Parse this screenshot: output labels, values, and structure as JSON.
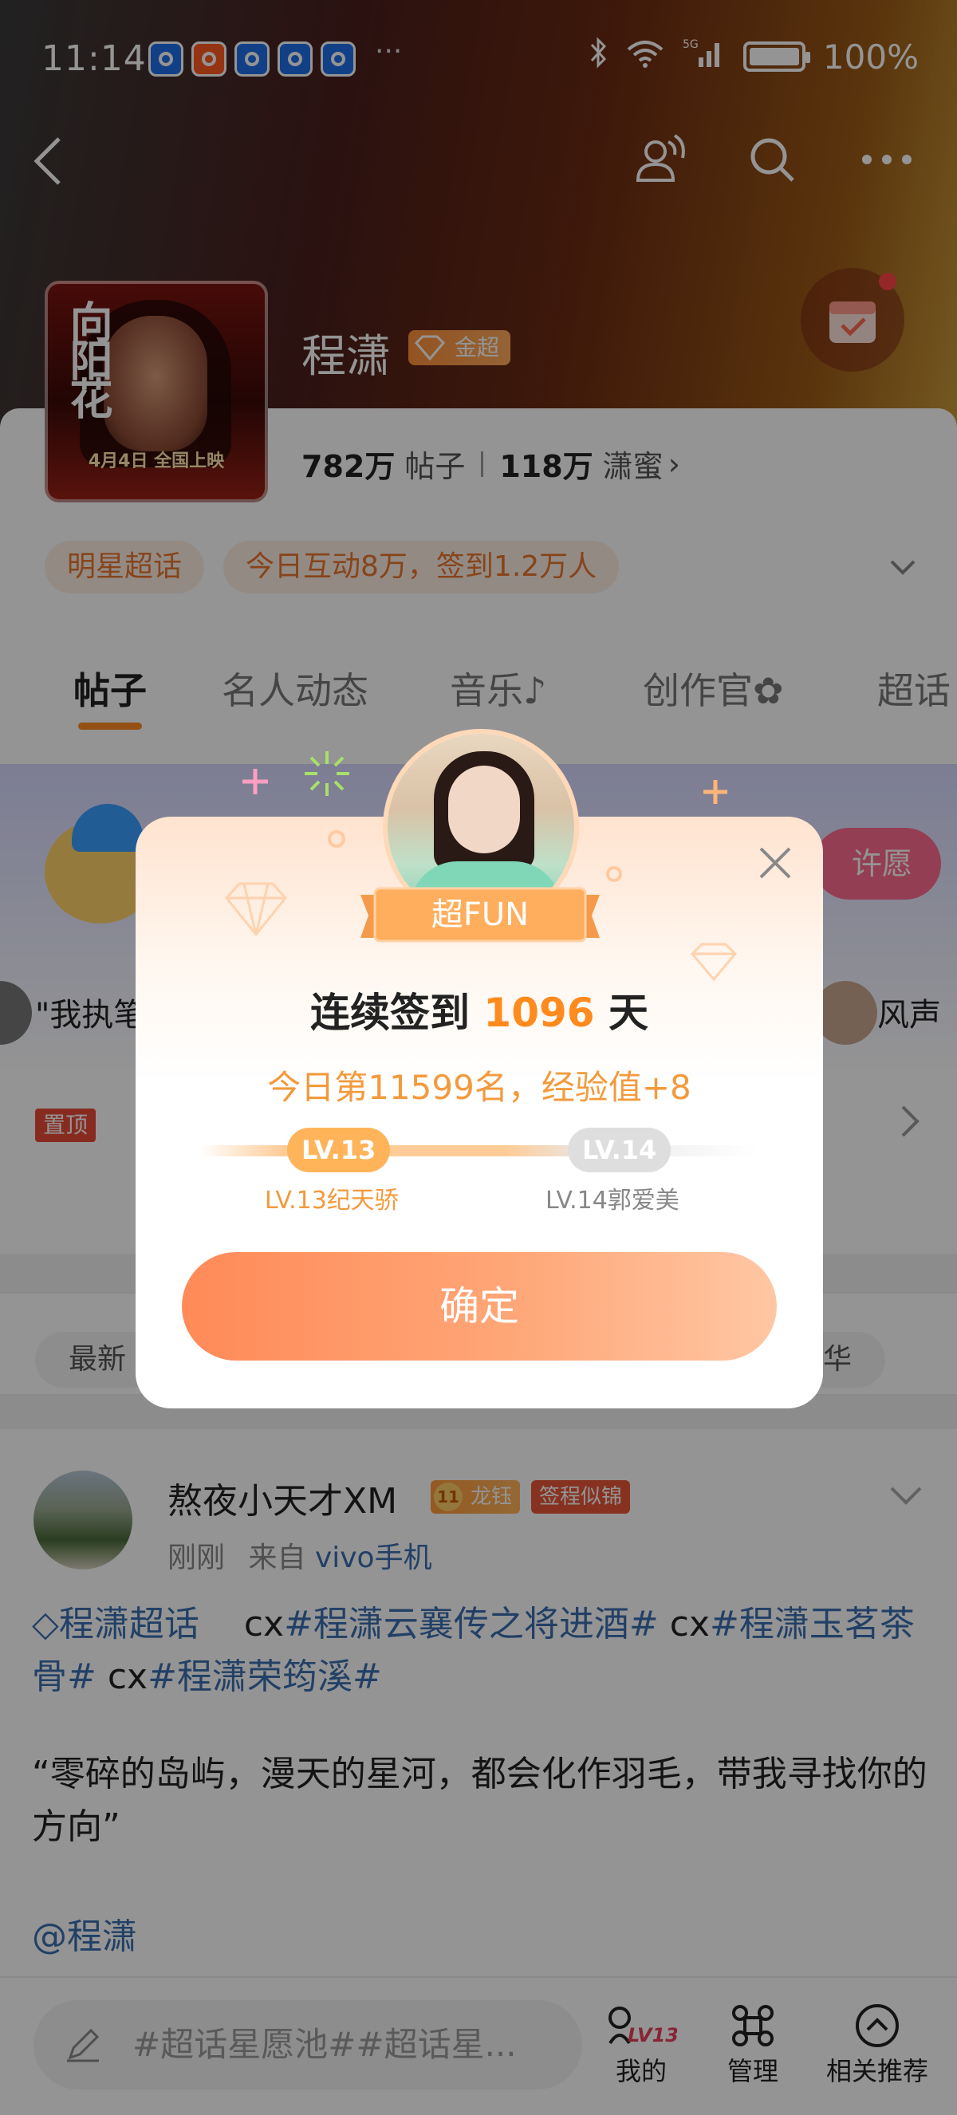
{
  "status_bar": {
    "time": "11:14",
    "battery": "100%",
    "network": "5G"
  },
  "topic": {
    "name": "程潇",
    "badge": "金超",
    "posts_count": "782万",
    "posts_label": "帖子",
    "fans_count": "118万",
    "fans_label": "潇蜜",
    "cover": {
      "title": "向阳花",
      "release": "4月4日 全国上映"
    }
  },
  "chips": [
    "明星超话",
    "今日互动8万，签到1.2万人"
  ],
  "tabs": [
    "帖子",
    "名人动态",
    "音乐",
    "创作官",
    "超话"
  ],
  "banner": {
    "wish_label": "许愿",
    "quote_left": "\"我执笔",
    "quote_right": "风声"
  },
  "pinned": {
    "tag": "置顶"
  },
  "filters": [
    "最新",
    "华"
  ],
  "post": {
    "author": "熬夜小天才XM",
    "level_badge": "龙钰",
    "level_num": "11",
    "sign_badge": "签程似锦",
    "time": "刚刚",
    "from_label": "来自",
    "device": "vivo手机",
    "topic_link": "程潇超话",
    "tags_text": [
      {
        "t": "cx",
        "link": false
      },
      {
        "t": "#程潇云襄传之将进酒#",
        "link": true
      },
      {
        "t": " cx",
        "link": false
      },
      {
        "t": "#程潇玉茗茶骨#",
        "link": true
      },
      {
        "t": " cx",
        "link": false
      },
      {
        "t": "#程潇荣筠溪#",
        "link": true
      }
    ],
    "body": "“零碎的岛屿，漫天的星河，都会化作羽毛，带我寻找你的方向”",
    "mention": "@程潇"
  },
  "bottom_bar": {
    "compose_placeholder": "#超话星愿池##超话星...",
    "my_label": "我的",
    "my_level": "LV13",
    "manage_label": "管理",
    "related_label": "相关推荐"
  },
  "dialog": {
    "ribbon": "超FUN",
    "title_prefix": "连续签到",
    "title_days": "1096",
    "title_suffix": "天",
    "subtitle": "今日第11599名，经验值+8",
    "current_level": "LV.13",
    "next_level": "LV.14",
    "current_level_name": "LV.13纪天骄",
    "next_level_name": "LV.14郭爱美",
    "confirm": "确定"
  },
  "colors": {
    "accent": "#ff8a24",
    "link": "#3b6fb0",
    "confirm": "#ff8a58"
  }
}
